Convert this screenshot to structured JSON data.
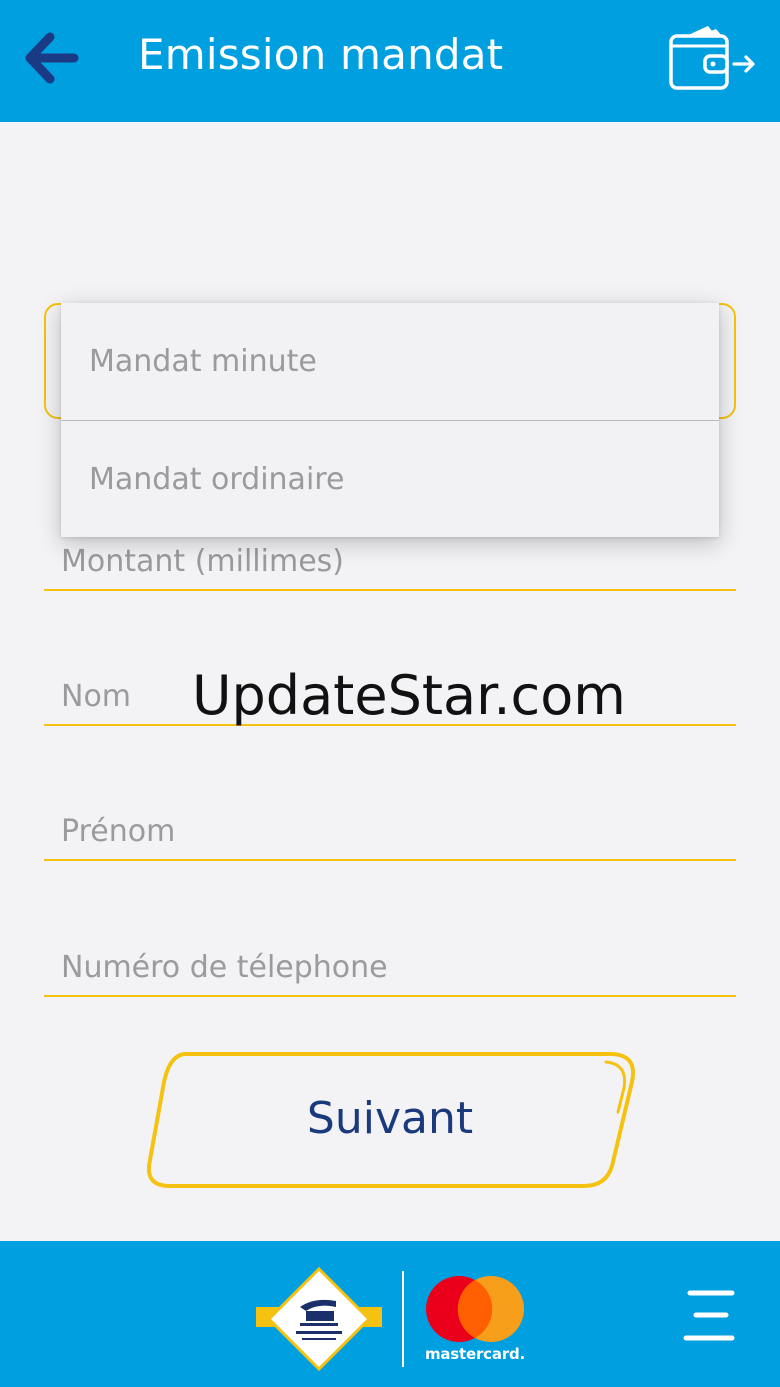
{
  "header": {
    "title": "Emission mandat",
    "back_icon": "arrow-left-icon",
    "wallet_icon": "wallet-logout-icon"
  },
  "form": {
    "fields": [
      {
        "label": "Montant (millimes)"
      },
      {
        "label": "Nom"
      },
      {
        "label": "Prénom"
      },
      {
        "label": "Numéro de télephone"
      }
    ]
  },
  "dropdown": {
    "options": [
      "Mandat minute",
      "Mandat ordinaire"
    ]
  },
  "watermark": "UpdateStar.com",
  "next_button": {
    "label": "Suivant"
  },
  "footer": {
    "mastercard_text": "mastercard.",
    "menu_icon": "hamburger-menu-icon"
  },
  "colors": {
    "primary_blue": "#009fdf",
    "accent_yellow": "#f5c211",
    "button_text": "#1a3a7c",
    "background": "#f3f3f6"
  }
}
